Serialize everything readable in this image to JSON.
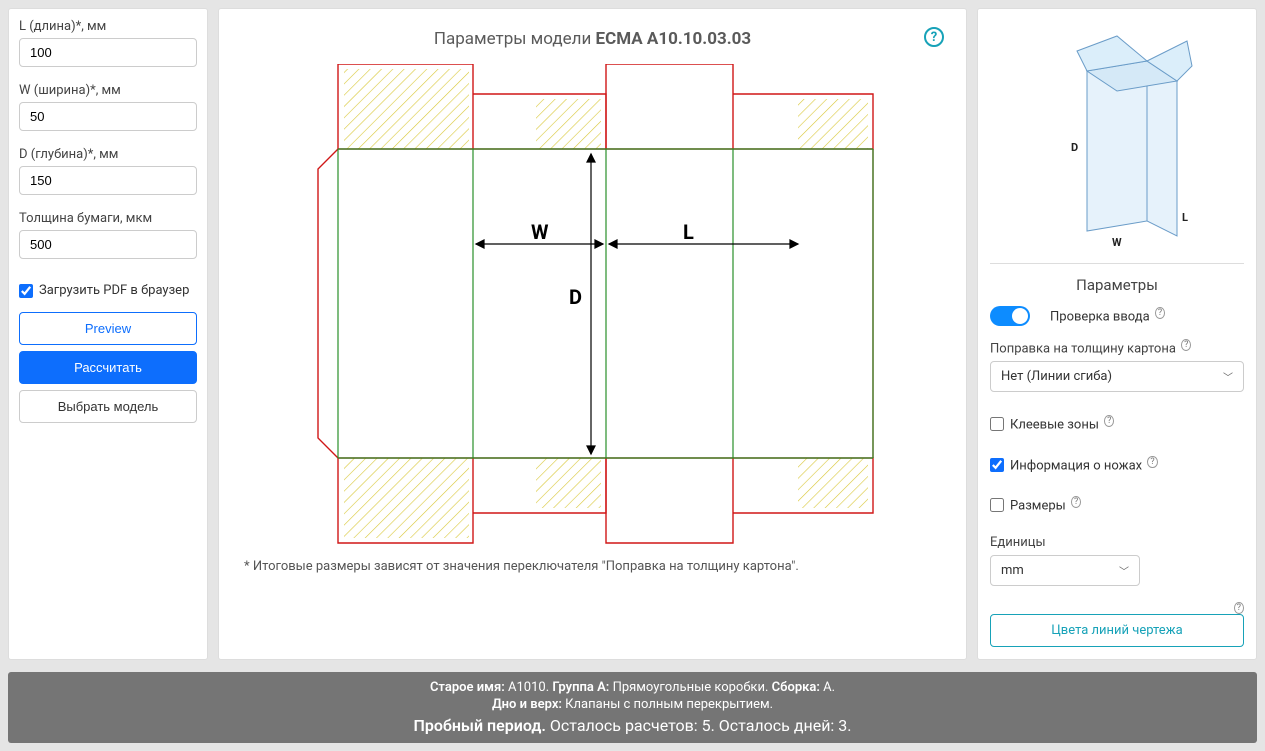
{
  "left": {
    "l_label": "L (длина)*, мм",
    "l_value": "100",
    "w_label": "W (ширина)*, мм",
    "w_value": "50",
    "d_label": "D (глубина)*, мм",
    "d_value": "150",
    "thickness_label": "Толщина бумаги, мкм",
    "thickness_value": "500",
    "pdf_checkbox_label": "Загрузить PDF в браузер",
    "preview_btn": "Preview",
    "calc_btn": "Рассчитать",
    "choose_btn": "Выбрать модель"
  },
  "center": {
    "title_prefix": "Параметры модели ",
    "title_model": "ECMA A10.10.03.03",
    "label_W": "W",
    "label_L": "L",
    "label_D": "D",
    "footnote": "* Итоговые размеры зависят от значения переключателя \"Поправка на толщину картона\"."
  },
  "right": {
    "axis_D": "D",
    "axis_L": "L",
    "axis_W": "W",
    "params_heading": "Параметры",
    "toggle_label": "Проверка ввода",
    "thickness_corr_label": "Поправка на толщину картона",
    "thickness_corr_value": "Нет (Линии сгиба)",
    "glue_label": "Клеевые зоны",
    "knives_label": "Информация о ножах",
    "sizes_label": "Размеры",
    "units_label": "Единицы",
    "units_value": "mm",
    "colors_btn": "Цвета линий чертежа"
  },
  "footer": {
    "old_name_label": "Старое имя:",
    "old_name_value": " A1010. ",
    "group_label": "Группа A:",
    "group_value": " Прямоугольные коробки. ",
    "assembly_label": "Сборка:",
    "assembly_value": " A.",
    "bottom_top_label": "Дно и верх:",
    "bottom_top_value": " Клапаны с полным перекрытием.",
    "trial_label": "Пробный период. ",
    "remaining": "Осталось расчетов: 5. Осталось дней: 3."
  }
}
